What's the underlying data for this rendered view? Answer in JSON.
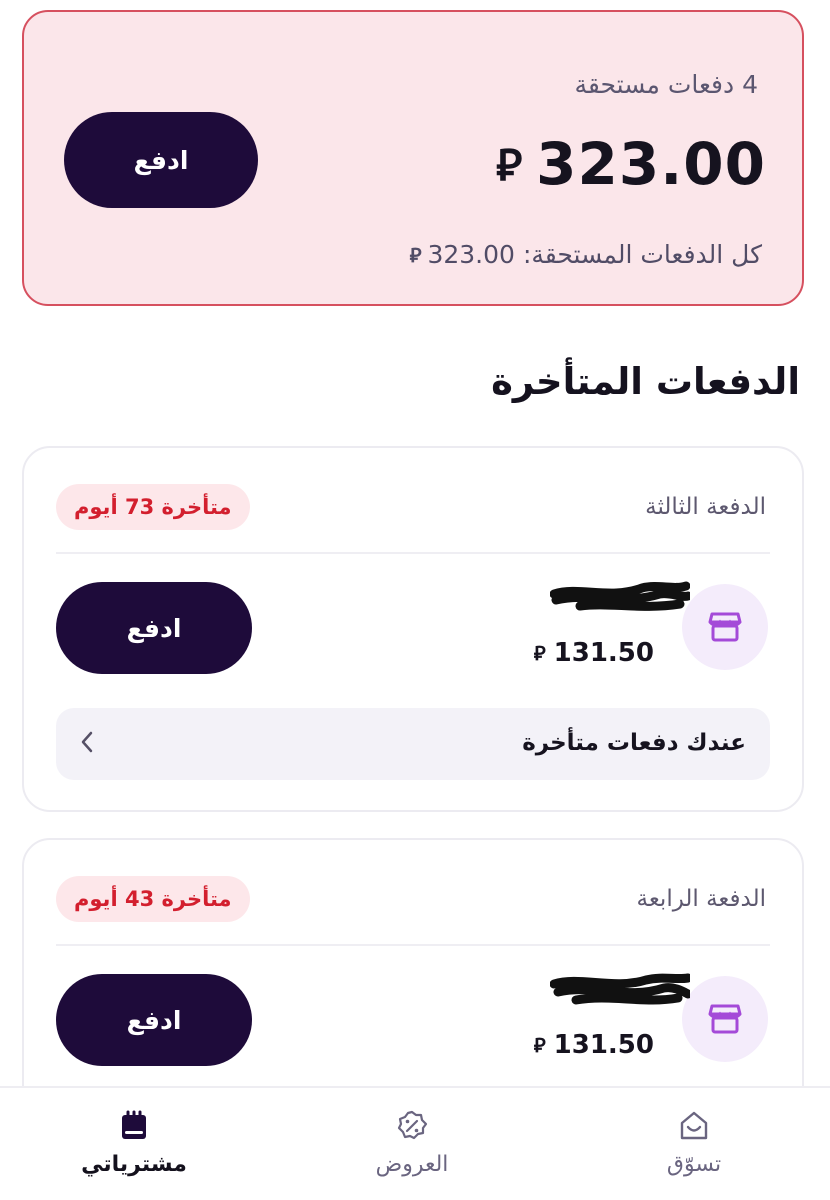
{
  "summary": {
    "due_count": "4 دفعات مستحقة",
    "total_amount": "323.00",
    "currency_symbol": "⃁",
    "all_due_label": "كل الدفعات المستحقة:",
    "all_due_amount": "323.00",
    "pay_label": "ادفع"
  },
  "section": {
    "title": "الدفعات المتأخرة"
  },
  "payments": [
    {
      "name": "الدفعة الثالثة",
      "late_badge": "متأخرة 73 أيوم",
      "amount": "131.50",
      "pay_label": "ادفع",
      "late_notice": "عندك دفعات متأخرة"
    },
    {
      "name": "الدفعة الرابعة",
      "late_badge": "متأخرة 43 أيوم",
      "amount": "131.50",
      "pay_label": "ادفع"
    }
  ],
  "nav": {
    "purchases": "مشترياتي",
    "offers": "العروض",
    "shop": "تسوّق"
  },
  "colors": {
    "brand_dark": "#1e0b3a",
    "alert_bg": "#fbe6ea",
    "alert_border": "#d6505f",
    "late_red": "#d31f2e",
    "store_icon_purple": "#a44ad8"
  },
  "icons": {
    "store": "store-icon",
    "chevron": "chevron-left-icon",
    "purchases": "bag-icon",
    "offers": "discount-badge-icon",
    "shop": "home-bag-icon"
  }
}
